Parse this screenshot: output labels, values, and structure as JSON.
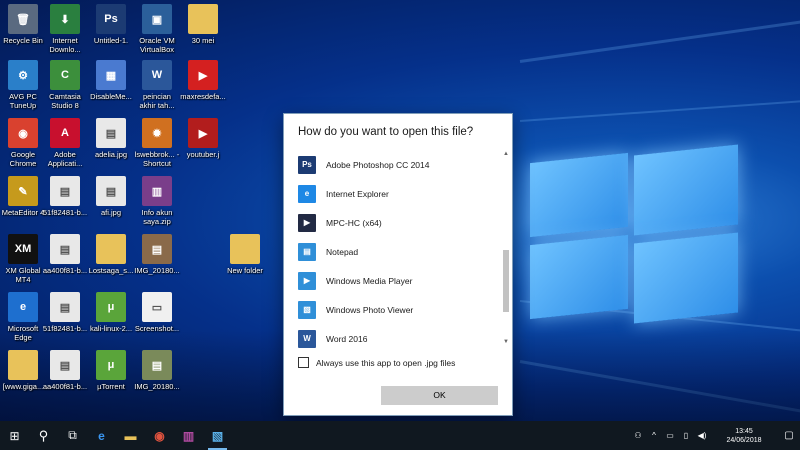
{
  "desktop": {
    "icons": [
      {
        "label": "Recycle Bin",
        "glyph": "🗑",
        "color": "#5a6a80"
      },
      {
        "label": "Internet Downlo...",
        "glyph": "⬇",
        "color": "#2a7f3f"
      },
      {
        "label": "Untitled-1.",
        "glyph": "Ps",
        "color": "#1c3b73"
      },
      {
        "label": "Oracle VM VirtualBox",
        "glyph": "▣",
        "color": "#2b5f9a"
      },
      {
        "label": "30 mei",
        "glyph": "",
        "color": "#e8c25a"
      },
      {
        "label": "AVG PC TuneUp",
        "glyph": "⚙",
        "color": "#2a7fc9"
      },
      {
        "label": "Camtasia Studio 8",
        "glyph": "C",
        "color": "#3c8f3c"
      },
      {
        "label": "DisableMe...",
        "glyph": "▦",
        "color": "#4a7ad0"
      },
      {
        "label": "peincian akhir tah...",
        "glyph": "W",
        "color": "#2b579a"
      },
      {
        "label": "maxresdefa...",
        "glyph": "▶",
        "color": "#d42020"
      },
      {
        "label": "Google Chrome",
        "glyph": "◉",
        "color": "#d9412f"
      },
      {
        "label": "Adobe Applicati...",
        "glyph": "A",
        "color": "#c8102e"
      },
      {
        "label": "adelia.jpg",
        "glyph": "▤",
        "color": "#e8e8e8"
      },
      {
        "label": "lswebbrok... - Shortcut",
        "glyph": "✹",
        "color": "#d07020"
      },
      {
        "label": "youtuber.j",
        "glyph": "▶",
        "color": "#b21d1d"
      },
      {
        "label": "MetaEditor 4",
        "glyph": "✎",
        "color": "#c69a1c"
      },
      {
        "label": "51f82481-b...",
        "glyph": "▤",
        "color": "#e8e8e8"
      },
      {
        "label": "afi.jpg",
        "glyph": "▤",
        "color": "#e8e8e8"
      },
      {
        "label": "Info akun saya.zip",
        "glyph": "▥",
        "color": "#7a3e8a"
      },
      {
        "label": "XM Global MT4",
        "glyph": "XM",
        "color": "#111111"
      },
      {
        "label": "aa400f81-b...",
        "glyph": "▤",
        "color": "#e8e8e8"
      },
      {
        "label": "Lostsaga_s...",
        "glyph": "",
        "color": "#e8c25a"
      },
      {
        "label": "IMG_20180...",
        "glyph": "▤",
        "color": "#8a6a4a"
      },
      {
        "label": "New folder",
        "glyph": "",
        "color": "#e8c25a"
      },
      {
        "label": "Microsoft Edge",
        "glyph": "e",
        "color": "#1e6fcf"
      },
      {
        "label": "51f82481-b...",
        "glyph": "▤",
        "color": "#e8e8e8"
      },
      {
        "label": "kali-linux-2...",
        "glyph": "μ",
        "color": "#5aa53a"
      },
      {
        "label": "Screenshot...",
        "glyph": "▭",
        "color": "#f0f0f0"
      },
      {
        "label": "[www.giga...",
        "glyph": "",
        "color": "#e8c25a"
      },
      {
        "label": "aa400f81-b...",
        "glyph": "▤",
        "color": "#e8e8e8"
      },
      {
        "label": "µTorrent",
        "glyph": "μ",
        "color": "#5aa53a"
      },
      {
        "label": "IMG_20180...",
        "glyph": "▤",
        "color": "#7a8a5a"
      }
    ]
  },
  "dialog": {
    "title": "How do you want to open this file?",
    "apps": [
      {
        "name": "Adobe Photoshop CC 2014",
        "glyph": "Ps",
        "color": "#1c3b73"
      },
      {
        "name": "Internet Explorer",
        "glyph": "e",
        "color": "#1e88e5"
      },
      {
        "name": "MPC-HC (x64)",
        "glyph": "▶",
        "color": "#222a44"
      },
      {
        "name": "Notepad",
        "glyph": "▤",
        "color": "#2f8fd8"
      },
      {
        "name": "Windows Media Player",
        "glyph": "▶",
        "color": "#2f8fd8"
      },
      {
        "name": "Windows Photo Viewer",
        "glyph": "▧",
        "color": "#2f8fd8"
      },
      {
        "name": "Word 2016",
        "glyph": "W",
        "color": "#2b579a"
      }
    ],
    "always_label": "Always use this app to open .jpg files",
    "always_checked": false,
    "ok_label": "OK"
  },
  "taskbar": {
    "start_glyph": "⊞",
    "search_glyph": "⚲",
    "taskview_glyph": "⧉",
    "apps": [
      {
        "name": "edge",
        "glyph": "e",
        "color": "#3a96f0",
        "active": false
      },
      {
        "name": "file-explorer",
        "glyph": "▬",
        "color": "#e8c25a",
        "active": false
      },
      {
        "name": "chrome",
        "glyph": "◉",
        "color": "#e0533f",
        "active": false
      },
      {
        "name": "winrar",
        "glyph": "▥",
        "color": "#b04aa0",
        "active": false
      },
      {
        "name": "photos",
        "glyph": "▧",
        "color": "#5ab0e8",
        "active": true
      }
    ],
    "time": "13:45",
    "date": "24/06/2018"
  }
}
